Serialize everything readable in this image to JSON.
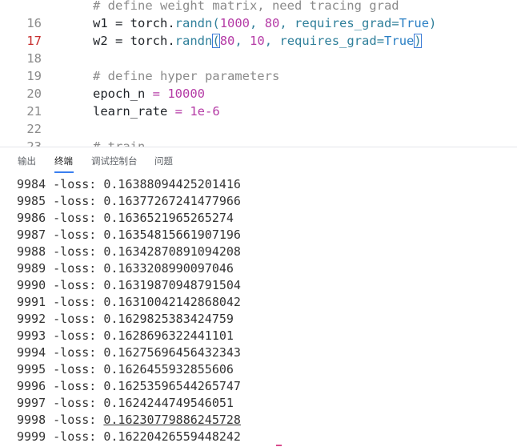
{
  "editor": {
    "lines": [
      {
        "num": "",
        "tokens": [
          {
            "t": "# define weight matrix, need tracing grad",
            "c": "cm"
          }
        ]
      },
      {
        "num": "16",
        "tokens": [
          {
            "t": "w1 ",
            "c": "op"
          },
          {
            "t": "= ",
            "c": "op"
          },
          {
            "t": "torch.",
            "c": "op"
          },
          {
            "t": "randn",
            "c": "fn"
          },
          {
            "t": "(",
            "c": "fn"
          },
          {
            "t": "1000",
            "c": "num"
          },
          {
            "t": ", ",
            "c": "fn"
          },
          {
            "t": "80",
            "c": "num"
          },
          {
            "t": ", ",
            "c": "fn"
          },
          {
            "t": "requires_grad",
            "c": "fn"
          },
          {
            "t": "=",
            "c": "fn"
          },
          {
            "t": "True",
            "c": "kw"
          },
          {
            "t": ")",
            "c": "fn"
          }
        ]
      },
      {
        "num": "17",
        "active": true,
        "tokens": [
          {
            "t": "w2 ",
            "c": "op"
          },
          {
            "t": "= ",
            "c": "op"
          },
          {
            "t": "torch.",
            "c": "op"
          },
          {
            "t": "randn",
            "c": "fn"
          },
          {
            "t": "(",
            "c": "fn",
            "match": true
          },
          {
            "t": "80",
            "c": "num"
          },
          {
            "t": ", ",
            "c": "fn"
          },
          {
            "t": "10",
            "c": "num"
          },
          {
            "t": ", ",
            "c": "fn"
          },
          {
            "t": "requires_grad",
            "c": "fn"
          },
          {
            "t": "=",
            "c": "fn"
          },
          {
            "t": "True",
            "c": "kw"
          },
          {
            "t": ")",
            "c": "fn",
            "match": true
          }
        ]
      },
      {
        "num": "18",
        "tokens": []
      },
      {
        "num": "19",
        "tokens": [
          {
            "t": "# define hyper parameters",
            "c": "cm"
          }
        ]
      },
      {
        "num": "20",
        "tokens": [
          {
            "t": "epoch_n ",
            "c": "op"
          },
          {
            "t": "= ",
            "c": "num"
          },
          {
            "t": "10000",
            "c": "num"
          }
        ]
      },
      {
        "num": "21",
        "tokens": [
          {
            "t": "learn_rate ",
            "c": "op"
          },
          {
            "t": "= ",
            "c": "num"
          },
          {
            "t": "1e-6",
            "c": "num"
          }
        ]
      },
      {
        "num": "22",
        "tokens": []
      },
      {
        "num": "23",
        "tokens": [
          {
            "t": "# train",
            "c": "cm"
          }
        ]
      }
    ]
  },
  "panel": {
    "tabs": [
      {
        "label": "输出",
        "active": false
      },
      {
        "label": "终端",
        "active": true
      },
      {
        "label": "调试控制台",
        "active": false
      },
      {
        "label": "问题",
        "active": false
      }
    ],
    "output": [
      "9984 -loss: 0.16388094425201416",
      "9985 -loss: 0.16377267241477966",
      "9986 -loss: 0.163652196526527 4",
      "9987 -loss: 0.16354815661907196",
      "9988 -loss: 0.16342870891094208",
      "9989 -loss: 0.1633208990097046",
      "9990 -loss: 0.16319870948791504",
      "9991 -loss: 0.16310042142868042",
      "9992 -loss: 0.1629825383424759",
      "9993 -loss: 0.1628696322441101",
      "9994 -loss: 0.16275696456432343",
      "9995 -loss: 0.1626455932855606",
      "9996 -loss: 0.16253596544265747",
      "9997 -loss: 0.1624244749546051",
      "9998 -loss: 0.16230779886245728",
      "9999 -loss: 0.16220426559448242"
    ],
    "underlined_index": 14
  }
}
